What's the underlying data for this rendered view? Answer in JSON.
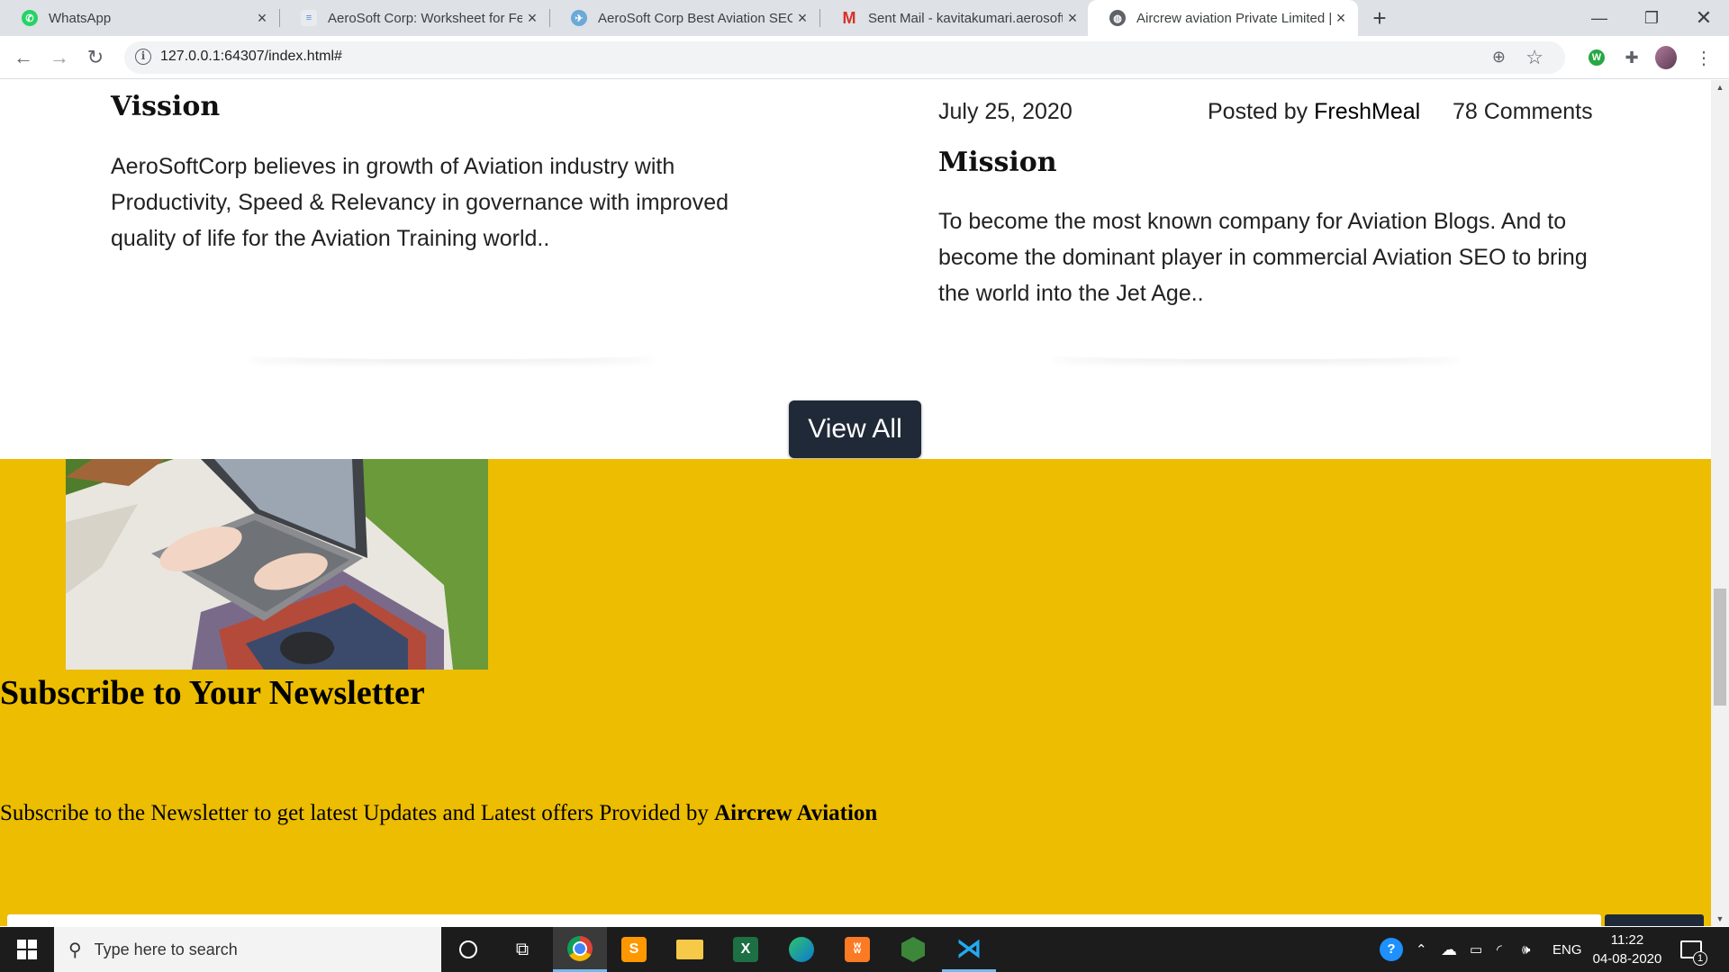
{
  "browser": {
    "tabs": [
      {
        "title": "WhatsApp",
        "icon": "whatsapp-icon",
        "active": false
      },
      {
        "title": "AeroSoft Corp: Worksheet for Fe",
        "icon": "doc-icon",
        "active": false
      },
      {
        "title": "AeroSoft Corp Best Aviation SEO",
        "icon": "plane-icon",
        "active": false
      },
      {
        "title": "Sent Mail - kavitakumari.aerosoft",
        "icon": "gmail-icon",
        "active": false
      },
      {
        "title": "Aircrew aviation Private Limited |",
        "icon": "globe-icon",
        "active": true
      }
    ],
    "url": "127.0.0.1:64307/index.html#"
  },
  "page": {
    "left_post": {
      "title": "Vission",
      "body": "AeroSoftCorp believes in growth of Aviation industry with Productivity, Speed & Relevancy in governance with improved quality of life for the Aviation Training world.."
    },
    "right_post": {
      "date": "July 25, 2020",
      "posted_by_label": "Posted by",
      "author": "FreshMeal",
      "comments": "78 Comments",
      "title": "Mission",
      "body": "To become the most known company for Aviation Blogs. And to become the dominant player in commercial Aviation SEO to bring the world into the Jet Age.."
    },
    "view_all_label": "View All",
    "newsletter": {
      "title": "Subscribe to Your Newsletter",
      "text": "Subscribe to the Newsletter to get latest Updates and Latest offers Provided by",
      "brand": "Aircrew Aviation"
    },
    "colors": {
      "newsletter_bg": "#ecbd00",
      "button_bg": "#1f2937"
    }
  },
  "taskbar": {
    "search_placeholder": "Type here to search",
    "apps": [
      "cortana-icon",
      "task-view-icon",
      "chrome-icon",
      "sublime-icon",
      "file-explorer-icon",
      "excel-icon",
      "edge-icon",
      "xampp-icon",
      "nodejs-icon",
      "vscode-icon"
    ],
    "language": "ENG",
    "time": "11:22",
    "date": "04-08-2020",
    "notification_count": "1"
  }
}
